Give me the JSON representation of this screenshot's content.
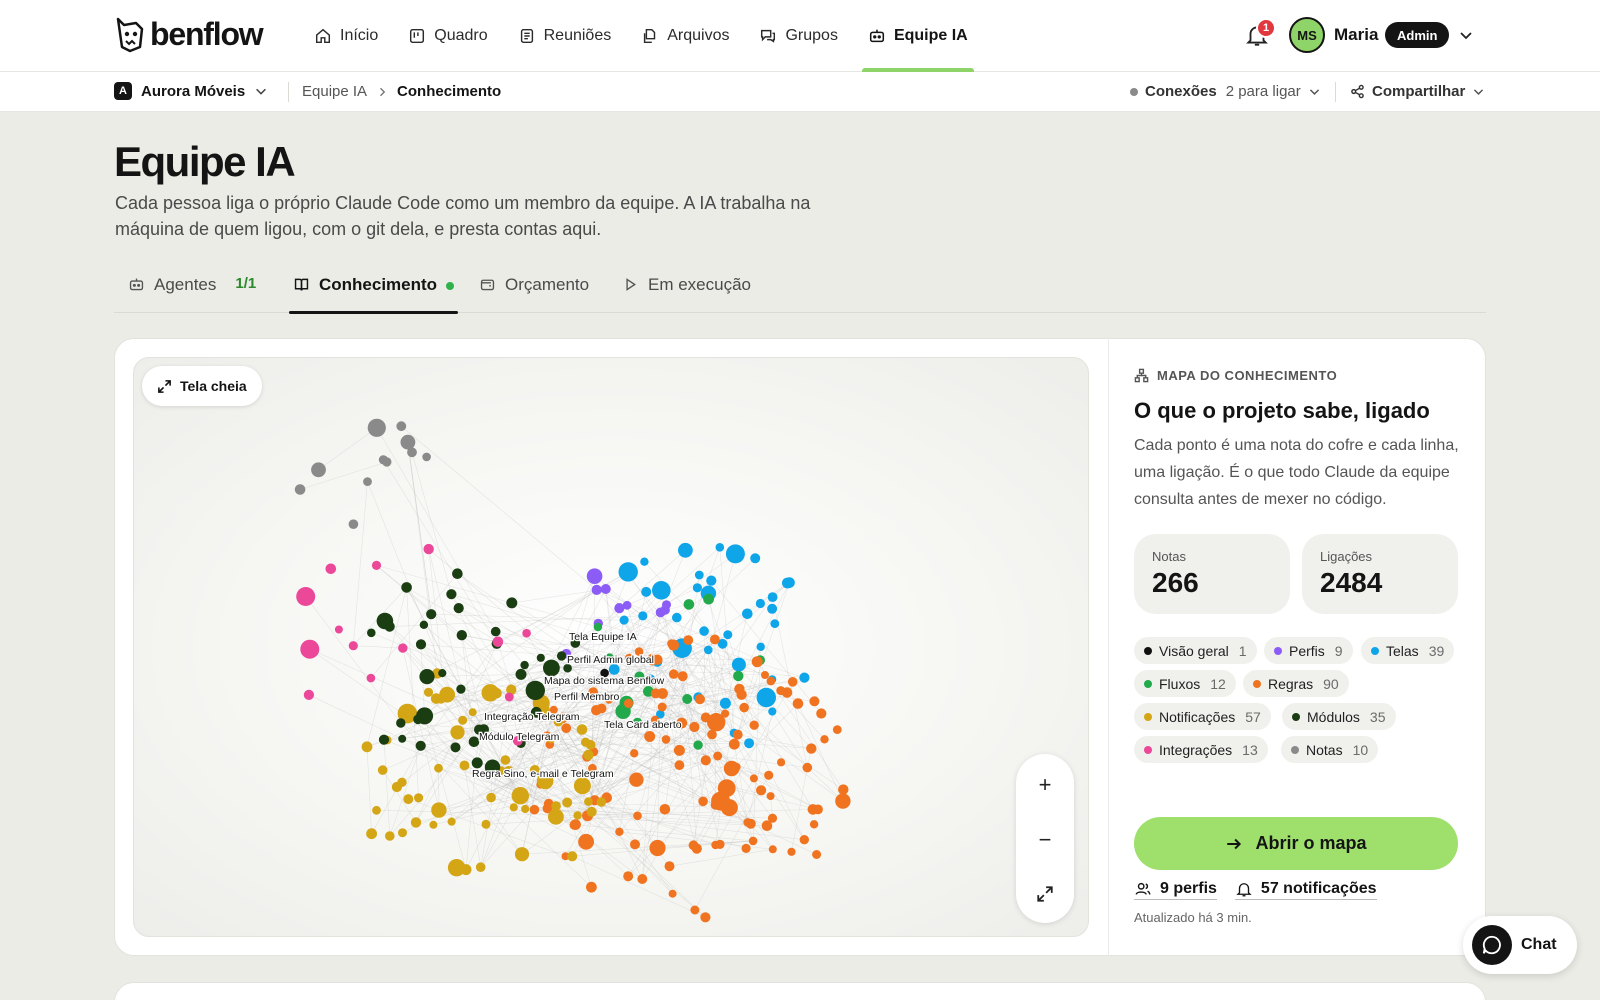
{
  "app": {
    "logo_text": "benflow"
  },
  "nav": {
    "items": [
      {
        "label": "Início",
        "icon": "home-icon"
      },
      {
        "label": "Quadro",
        "icon": "board-icon"
      },
      {
        "label": "Reuniões",
        "icon": "notes-icon"
      },
      {
        "label": "Arquivos",
        "icon": "files-icon"
      },
      {
        "label": "Grupos",
        "icon": "chat-bubbles-icon"
      },
      {
        "label": "Equipe IA",
        "icon": "robot-icon"
      }
    ],
    "active": "Equipe IA"
  },
  "user": {
    "notifications": "1",
    "initials": "MS",
    "name": "Maria",
    "role": "Admin"
  },
  "subbar": {
    "workspace_initial": "A",
    "workspace": "Aurora Móveis",
    "breadcrumb": [
      "Equipe IA",
      "Conhecimento"
    ],
    "connections_label": "Conexões",
    "connections_value": "2 para ligar",
    "share_label": "Compartilhar"
  },
  "page": {
    "title": "Equipe IA",
    "description": "Cada pessoa liga o próprio Claude Code como um membro da equipe. A IA trabalha na máquina de quem ligou, com o git dela, e presta contas aqui."
  },
  "tabs": [
    {
      "label": "Agentes",
      "count": "1/1",
      "icon": "robot-icon"
    },
    {
      "label": "Conhecimento",
      "icon": "book-icon",
      "active": true,
      "status_dot": true
    },
    {
      "label": "Orçamento",
      "icon": "wallet-icon"
    },
    {
      "label": "Em execução",
      "icon": "play-icon"
    }
  ],
  "graph": {
    "fullscreen_label": "Tela cheia",
    "labels": [
      "Tela Equipe IA",
      "Perfil Admin global",
      "Mapa do sistema Benflow",
      "Perfil Membro",
      "Integração Telegram",
      "Tela Card aberto",
      "Módulo Telegram",
      "Regra Sino, e-mail e Telegram"
    ],
    "zoom_in": "+",
    "zoom_out": "−"
  },
  "knowledge": {
    "eyebrow": "MAPA DO CONHECIMENTO",
    "title": "O que o projeto sabe, ligado",
    "description": "Cada ponto é uma nota do cofre e cada linha, uma ligação. É o que todo Claude da equipe consulta antes de mexer no código.",
    "notes_label": "Notas",
    "notes_value": "266",
    "links_label": "Ligações",
    "links_value": "2484",
    "categories": [
      {
        "label": "Visão geral",
        "count": "1",
        "color": "#111111"
      },
      {
        "label": "Perfis",
        "count": "9",
        "color": "#8b5cf6"
      },
      {
        "label": "Telas",
        "count": "39",
        "color": "#0ea5e9"
      },
      {
        "label": "Fluxos",
        "count": "12",
        "color": "#22a94b"
      },
      {
        "label": "Regras",
        "count": "90",
        "color": "#f07420"
      },
      {
        "label": "Notificações",
        "count": "57",
        "color": "#d4a514"
      },
      {
        "label": "Módulos",
        "count": "35",
        "color": "#1b3d12"
      },
      {
        "label": "Integrações",
        "count": "13",
        "color": "#ec4899"
      },
      {
        "label": "Notas",
        "count": "10",
        "color": "#8a8a8a"
      }
    ],
    "open_map_label": "Abrir o mapa",
    "profiles_link": "9 perfis",
    "notifications_link": "57 notificações",
    "updated": "Atualizado há 3 min."
  },
  "chat": {
    "label": "Chat"
  }
}
